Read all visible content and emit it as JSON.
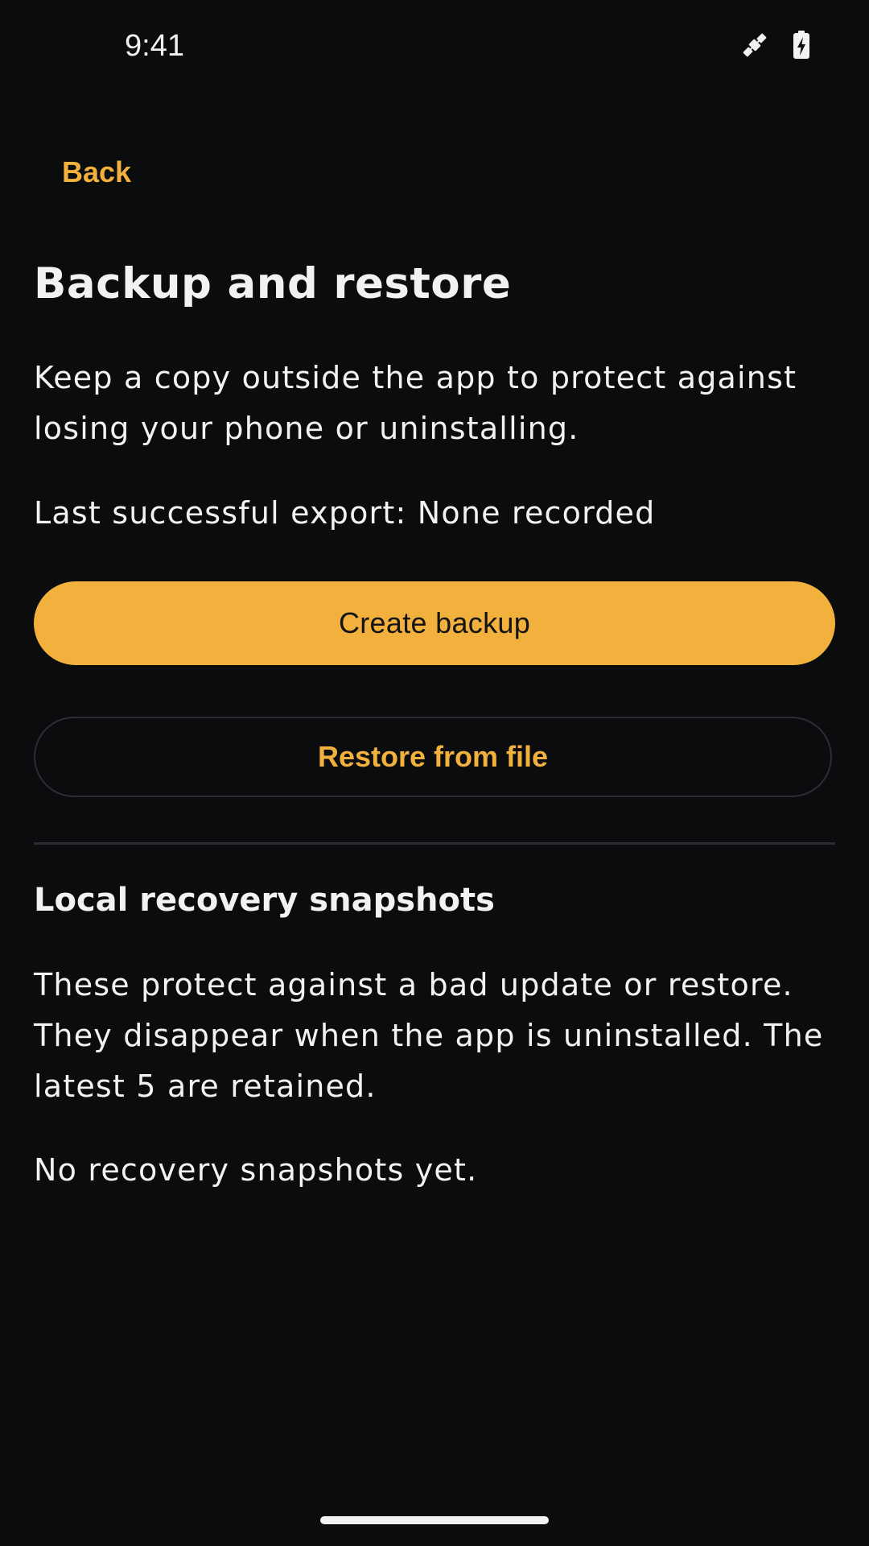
{
  "status_bar": {
    "time": "9:41",
    "icons": [
      "satellite-icon",
      "battery-charging-icon"
    ]
  },
  "nav": {
    "back_label": "Back"
  },
  "page": {
    "title": "Backup and restore",
    "intro": "Keep a copy outside the app to protect against losing your phone or uninstalling.",
    "last_export": "Last successful export: None recorded"
  },
  "actions": {
    "create_backup_label": "Create backup",
    "restore_label": "Restore from file"
  },
  "snapshots": {
    "title": "Local recovery snapshots",
    "description": "These protect against a bad update or restore. They disappear when the app is uninstalled. The latest 5 are retained.",
    "empty_text": "No recovery snapshots yet."
  },
  "colors": {
    "background": "#0b0c0e",
    "accent": "#f2b03c",
    "text": "#f2f2f2",
    "outline": "#2c2e32"
  }
}
